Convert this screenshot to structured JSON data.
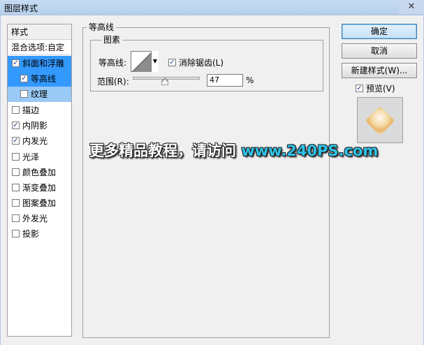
{
  "window": {
    "title": "图层样式",
    "close_glyph": "✕"
  },
  "stylelist": {
    "header": "样式",
    "blend": "混合选项:自定",
    "items": [
      {
        "label": "斜面和浮雕",
        "checked": true
      },
      {
        "label": "等高线",
        "checked": true
      },
      {
        "label": "纹理",
        "checked": false
      },
      {
        "label": "描边",
        "checked": false
      },
      {
        "label": "内阴影",
        "checked": true
      },
      {
        "label": "内发光",
        "checked": true
      },
      {
        "label": "光泽",
        "checked": false
      },
      {
        "label": "颜色叠加",
        "checked": false
      },
      {
        "label": "渐变叠加",
        "checked": false
      },
      {
        "label": "图案叠加",
        "checked": false
      },
      {
        "label": "外发光",
        "checked": false
      },
      {
        "label": "投影",
        "checked": false
      }
    ]
  },
  "contour_panel": {
    "group_title": "等高线",
    "subgroup_title": "图素",
    "contour_label": "等高线:",
    "antialias_label": "消除锯齿(L)",
    "antialias_checked": true,
    "range_label": "范围(R):",
    "range_value": "47",
    "range_unit": "%",
    "range_fraction": 0.47
  },
  "buttons": {
    "ok": "确定",
    "cancel": "取消",
    "new_style": "新建样式(W)...",
    "preview_label": "预览(V)",
    "preview_checked": true
  },
  "watermark": {
    "text": "更多精品教程，请访问 ",
    "url": "www.240PS.com"
  },
  "colors": {
    "selected": "#3399ff",
    "selected_sub": "#99c9f5",
    "watermark_url": "#2ec3e8"
  }
}
